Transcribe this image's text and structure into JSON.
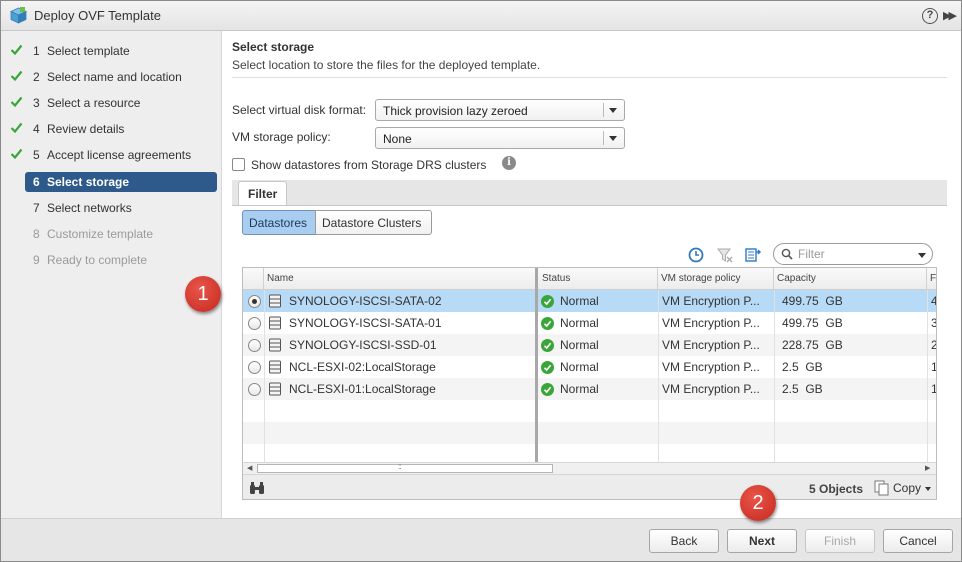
{
  "window": {
    "title": "Deploy OVF Template",
    "help_glyph": "?",
    "expand_glyph": "▶▶"
  },
  "nav": {
    "steps": [
      {
        "num": "1",
        "label": "Select template",
        "state": "done"
      },
      {
        "num": "2",
        "label": "Select name and location",
        "state": "done"
      },
      {
        "num": "3",
        "label": "Select a resource",
        "state": "done"
      },
      {
        "num": "4",
        "label": "Review details",
        "state": "done"
      },
      {
        "num": "5",
        "label": "Accept license agreements",
        "state": "done"
      },
      {
        "num": "6",
        "label": "Select storage",
        "state": "active"
      },
      {
        "num": "7",
        "label": "Select networks",
        "state": "pending"
      },
      {
        "num": "8",
        "label": "Customize template",
        "state": "disabled"
      },
      {
        "num": "9",
        "label": "Ready to complete",
        "state": "disabled"
      }
    ]
  },
  "content": {
    "title": "Select storage",
    "subtitle": "Select location to store the files for the deployed template.",
    "disk_format": {
      "label": "Select virtual disk format:",
      "value": "Thick provision lazy zeroed"
    },
    "storage_policy": {
      "label": "VM storage policy:",
      "value": "None"
    },
    "show_drs": {
      "label": "Show datastores from Storage DRS clusters",
      "checked": false,
      "info_glyph": "i"
    },
    "filter_tab": "Filter",
    "segments": {
      "datastores": "Datastores",
      "clusters": "Datastore Clusters",
      "selected": "datastores"
    },
    "filter_search": {
      "placeholder": "Filter"
    },
    "grid": {
      "columns": [
        "Name",
        "Status",
        "VM storage policy",
        "Capacity",
        "F"
      ],
      "rows": [
        {
          "name": "SYNOLOGY-ISCSI-SATA-02",
          "status": "Normal",
          "policy": "VM Encryption P...",
          "capacity": "499.75  GB",
          "free": "4",
          "selected": true
        },
        {
          "name": "SYNOLOGY-ISCSI-SATA-01",
          "status": "Normal",
          "policy": "VM Encryption P...",
          "capacity": "499.75  GB",
          "free": "3",
          "selected": false
        },
        {
          "name": "SYNOLOGY-ISCSI-SSD-01",
          "status": "Normal",
          "policy": "VM Encryption P...",
          "capacity": "228.75  GB",
          "free": "2",
          "selected": false
        },
        {
          "name": "NCL-ESXI-02:LocalStorage",
          "status": "Normal",
          "policy": "VM Encryption P...",
          "capacity": "2.5  GB",
          "free": "1",
          "selected": false
        },
        {
          "name": "NCL-ESXI-01:LocalStorage",
          "status": "Normal",
          "policy": "VM Encryption P...",
          "capacity": "2.5  GB",
          "free": "1",
          "selected": false
        }
      ],
      "object_count": "5 Objects",
      "copy_label": "Copy",
      "scroll_grip": "::",
      "scroll_left_glyph": "◀",
      "scroll_right_glyph": "▶"
    }
  },
  "buttons": {
    "back": "Back",
    "next": "Next",
    "finish": "Finish",
    "cancel": "Cancel"
  },
  "callouts": {
    "one": "1",
    "two": "2"
  },
  "colors": {
    "accent_nav": "#2d5a8a",
    "row_selected": "#b7daf6",
    "segment_selected": "#a9cdf0",
    "status_ok": "#3aa63a",
    "callout": "#d3362b"
  }
}
